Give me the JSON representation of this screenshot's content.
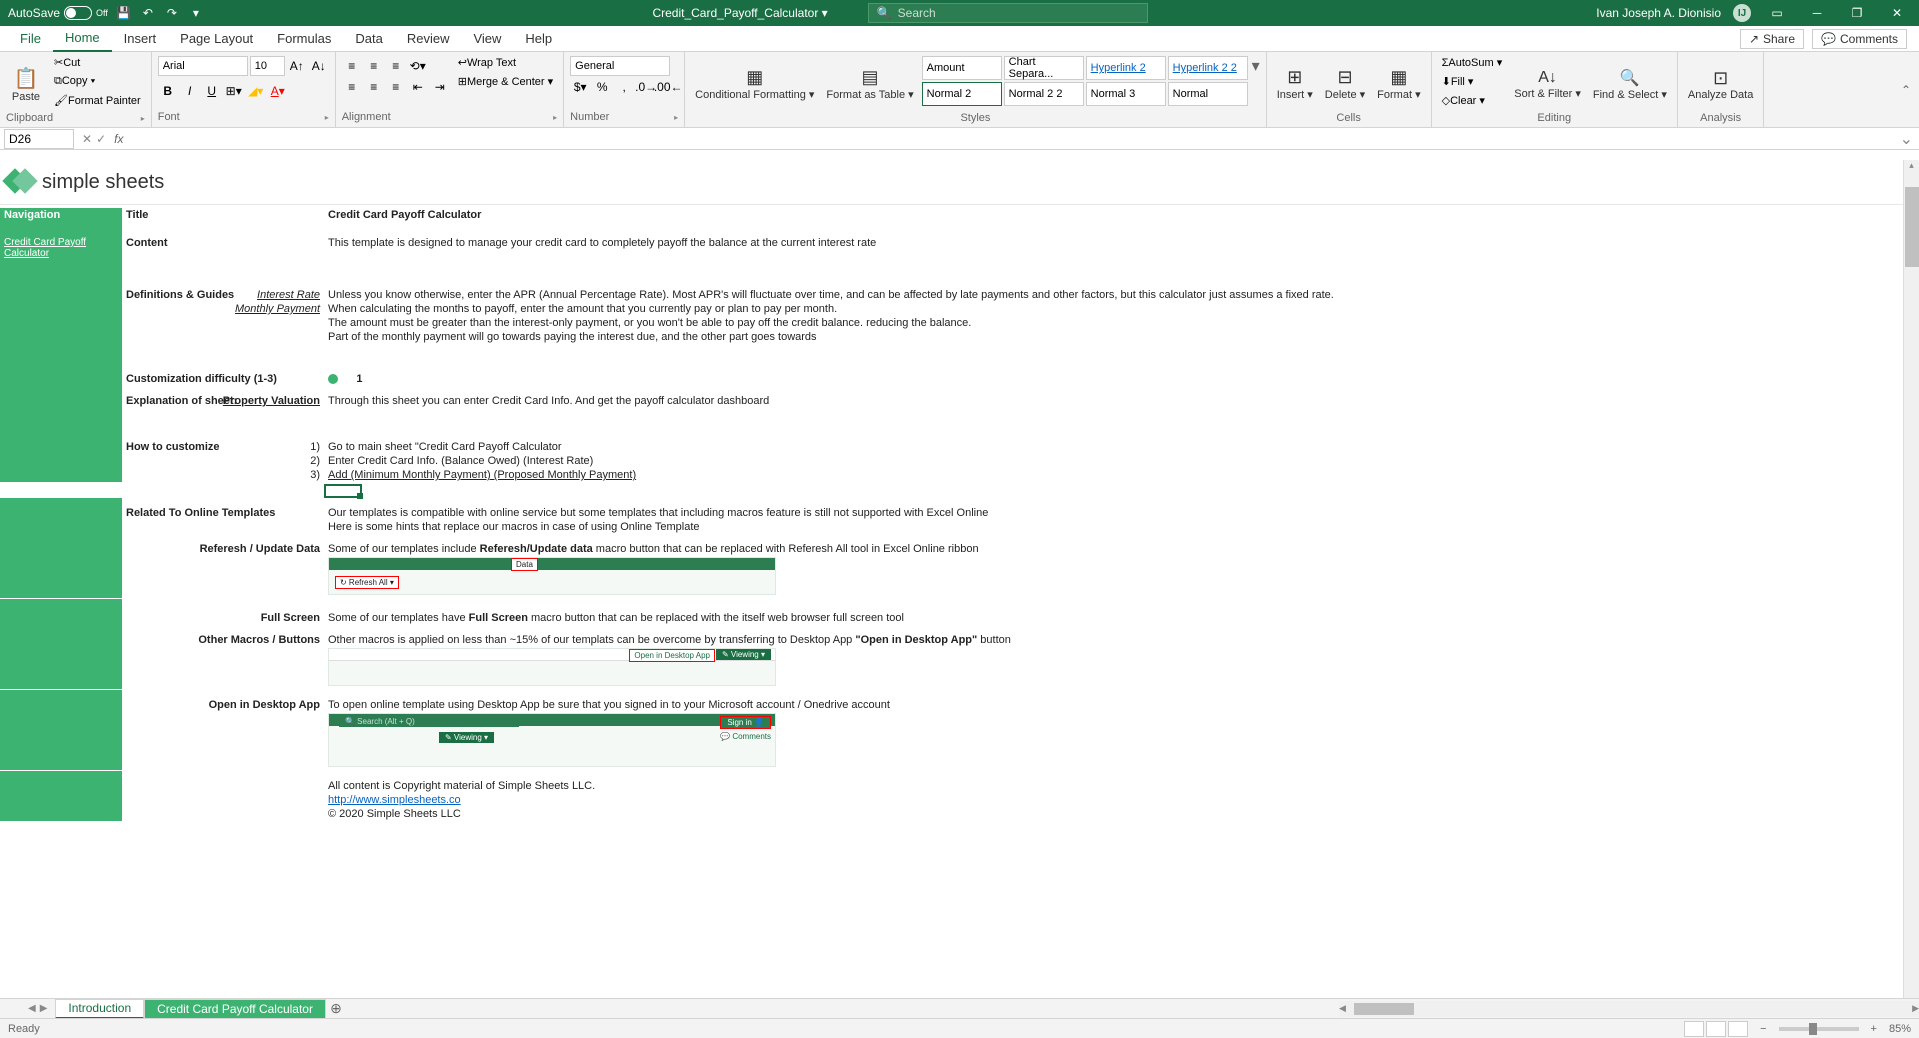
{
  "titlebar": {
    "autosave": "AutoSave",
    "autosave_state": "Off",
    "doc_name": "Credit_Card_Payoff_Calculator ▾",
    "search_placeholder": "Search",
    "username": "Ivan Joseph A. Dionisio",
    "user_initial": "IJ"
  },
  "tabs": {
    "file": "File",
    "home": "Home",
    "insert": "Insert",
    "page_layout": "Page Layout",
    "formulas": "Formulas",
    "data": "Data",
    "review": "Review",
    "view": "View",
    "help": "Help",
    "share": "Share",
    "comments": "Comments"
  },
  "ribbon": {
    "paste": "Paste",
    "cut": "Cut",
    "copy": "Copy ▾",
    "format_painter": "Format Painter",
    "clipboard": "Clipboard",
    "font_name": "Arial",
    "font_size": "10",
    "font": "Font",
    "wrap_text": "Wrap Text",
    "merge_center": "Merge & Center ▾",
    "alignment": "Alignment",
    "num_format": "General",
    "number": "Number",
    "cond_fmt": "Conditional Formatting ▾",
    "fmt_table": "Format as Table ▾",
    "style_amount": "Amount",
    "style_chart": "Chart Separa...",
    "style_hyper2": "Hyperlink 2",
    "style_hyper22": "Hyperlink 2 2",
    "style_normal2": "Normal 2",
    "style_normal22": "Normal 2 2",
    "style_normal3": "Normal 3",
    "style_normal": "Normal",
    "styles": "Styles",
    "insert_btn": "Insert ▾",
    "delete_btn": "Delete ▾",
    "format_btn": "Format ▾",
    "cells": "Cells",
    "autosum": "AutoSum ▾",
    "fill": "Fill ▾",
    "clear": "Clear ▾",
    "sort_filter": "Sort & Filter ▾",
    "find_select": "Find & Select ▾",
    "editing": "Editing",
    "analyze": "Analyze Data",
    "analysis": "Analysis"
  },
  "formula_bar": {
    "cell_ref": "D26",
    "formula": ""
  },
  "sheet": {
    "logo_text": "simple sheets",
    "nav_header": "Navigation",
    "nav_link": "Credit Card Payoff Calculator",
    "title_label": "Title",
    "title_val": "Credit Card Payoff Calculator",
    "content_label": "Content",
    "content_val": "This template is designed to manage your credit card to completely payoff the balance at the current interest rate",
    "defs_label": "Definitions & Guides",
    "interest_rate": "Interest Rate",
    "interest_rate_desc": "Unless you know otherwise, enter the APR (Annual Percentage Rate). Most APR's will fluctuate over time, and can be affected by late payments and other factors, but this calculator just assumes a fixed rate.",
    "monthly_payment": "Monthly Payment",
    "monthly_payment_desc": "When calculating the months to payoff, enter the amount that you currently pay or plan to pay per month.",
    "monthly_note1": "The amount must be greater than the interest-only payment, or you won't be able to pay off the credit balance. reducing the balance.",
    "monthly_note2": "Part of the monthly payment will go towards paying the interest due, and the other part goes towards",
    "cust_diff_label": "Customization difficulty (1-3)",
    "cust_diff_val": "1",
    "explan_label": "Explanation of sheet:",
    "prop_val": "Property Valuation",
    "prop_desc": "Through this sheet you can enter Credit Card Info. And get the payoff calculator dashboard",
    "howto_label": "How to customize",
    "step1_num": "1)",
    "step1": "Go to main sheet \"Credit Card Payoff Calculator",
    "step2_num": "2)",
    "step2": "Enter Credit Card Info. (Balance Owed) (Interest Rate)",
    "step3_num": "3)",
    "step3": "Add (Minimum Monthly Payment) (Proposed Monthly Payment)",
    "related_label": "Related To Online Templates",
    "related_desc": "Our templates is compatible with online service but some templates that including macros feature is still not supported with Excel Online",
    "related_hint": "Here is some hints that replace our macros in case of using Online Template",
    "refresh_label": "Referesh / Update Data",
    "refresh_pre": "Some of our templates include ",
    "refresh_bold": "Referesh/Update data",
    "refresh_post": " macro button that can be replaced with Referesh All tool in Excel Online ribbon",
    "fullscreen_label": "Full Screen",
    "fullscreen_pre": "Some of our templates have ",
    "fullscreen_bold": "Full Screen",
    "fullscreen_post": " macro button that can be replaced with the itself web browser full screen tool",
    "macros_label": "Other Macros / Buttons",
    "macros_pre": "Other macros is applied on less than ~15% of our templats can be overcome by transferring to Desktop App ",
    "macros_bold": "\"Open in Desktop App\"",
    "macros_post": " button",
    "desktop_label": "Open in Desktop App",
    "desktop_desc": "To open online template using Desktop App be sure that you signed in to your Microsoft account / Onedrive account",
    "copyright1": "All content is Copyright material of Simple Sheets LLC.",
    "copyright_link": "http://www.simplesheets.co",
    "copyright2": "© 2020 Simple Sheets LLC"
  },
  "sheet_tabs": {
    "intro": "Introduction",
    "calc": "Credit Card Payoff Calculator"
  },
  "status": {
    "ready": "Ready",
    "zoom": "85%"
  }
}
